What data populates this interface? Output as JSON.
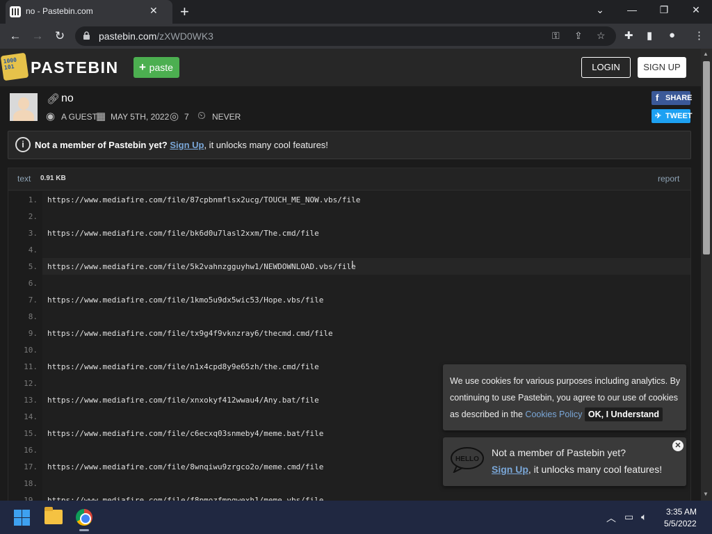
{
  "browser": {
    "tab_title": "no - Pastebin.com",
    "url_host": "pastebin.com",
    "url_path": "/zXWD0WK3"
  },
  "header": {
    "logo_text": "PASTEBIN",
    "logo_badge": "1000\n101",
    "paste_button": "paste",
    "login_button": "LOGIN",
    "signup_button": "SIGN UP"
  },
  "paste": {
    "title": "no",
    "author": "A GUEST",
    "date": "MAY 5TH, 2022",
    "views": "7",
    "expiry": "NEVER",
    "share_label": "SHARE",
    "tweet_label": "TWEET"
  },
  "notice": {
    "bold_text": "Not a member of Pastebin yet?",
    "link_text": "Sign Up",
    "rest_text": ", it unlocks many cool features!"
  },
  "code": {
    "language": "text",
    "size": "0.91 KB",
    "report_label": "report",
    "lines": [
      "https://www.mediafire.com/file/87cpbnmflsx2ucg/TOUCH_ME_NOW.vbs/file",
      "",
      "https://www.mediafire.com/file/bk6d0u7lasl2xxm/The.cmd/file",
      "",
      "https://www.mediafire.com/file/5k2vahnzgguyhw1/NEWDOWNLOAD.vbs/file",
      "",
      "https://www.mediafire.com/file/1kmo5u9dx5wic53/Hope.vbs/file",
      "",
      "https://www.mediafire.com/file/tx9g4f9vknzray6/thecmd.cmd/file",
      "",
      "https://www.mediafire.com/file/n1x4cpd8y9e65zh/the.cmd/file",
      "",
      "https://www.mediafire.com/file/xnxokyf412wwau4/Any.bat/file",
      "",
      "https://www.mediafire.com/file/c6ecxq03snmeby4/meme.bat/file",
      "",
      "https://www.mediafire.com/file/8wnqiwu9zrgco2o/meme.cmd/file",
      "",
      "https://www.mediafire.com/file/f8pmozfmpgwexh1/meme.vbs/file"
    ]
  },
  "cookie_banner": {
    "text_before": "We use cookies for various purposes including analytics. By continuing to use Pastebin, you agree to our use of cookies as described in the",
    "link_text": "Cookies Policy",
    "button_label": "OK, I Understand"
  },
  "hello_popup": {
    "bubble_text": "HELLO",
    "line1": "Not a member of Pastebin yet?",
    "link_text": "Sign Up",
    "line2_rest": ", it unlocks many cool features!"
  },
  "taskbar": {
    "time": "3:35 AM",
    "date": "5/5/2022"
  },
  "colors": {
    "accent_green": "#4caf50",
    "link_blue": "#7aa7d8",
    "facebook": "#3b5998",
    "twitter": "#1da1f2"
  }
}
